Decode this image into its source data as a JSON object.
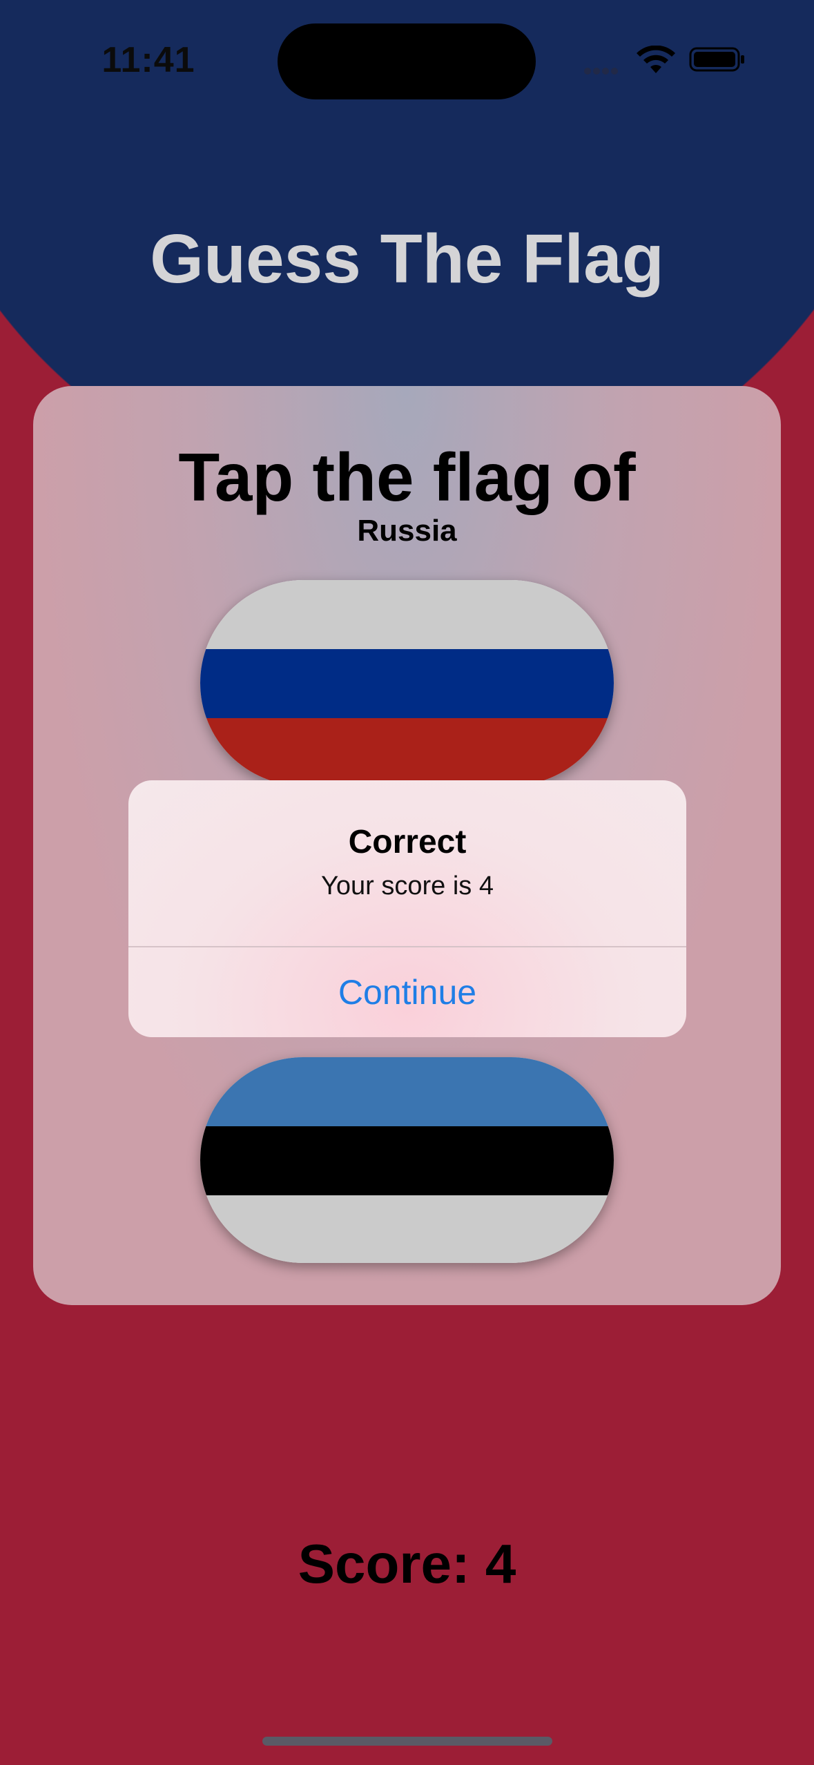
{
  "status_bar": {
    "time": "11:41"
  },
  "header": {
    "title": "Guess The Flag"
  },
  "card": {
    "prompt": "Tap the flag of",
    "country": "Russia",
    "flags": [
      {
        "name": "Russia",
        "stripes": [
          "#cbcbcb",
          "#002c86",
          "#aa2119"
        ]
      },
      {
        "name": "Estonia",
        "stripes": [
          "#3b75b1",
          "#000000",
          "#cbcbcb"
        ]
      }
    ]
  },
  "footer": {
    "score_label": "Score: 4"
  },
  "alert": {
    "title": "Correct",
    "message": "Your score is 4",
    "button_label": "Continue"
  },
  "colors": {
    "top_background": "#152a5c",
    "bottom_background": "#9c1e36",
    "accent": "#1f7ee6"
  }
}
